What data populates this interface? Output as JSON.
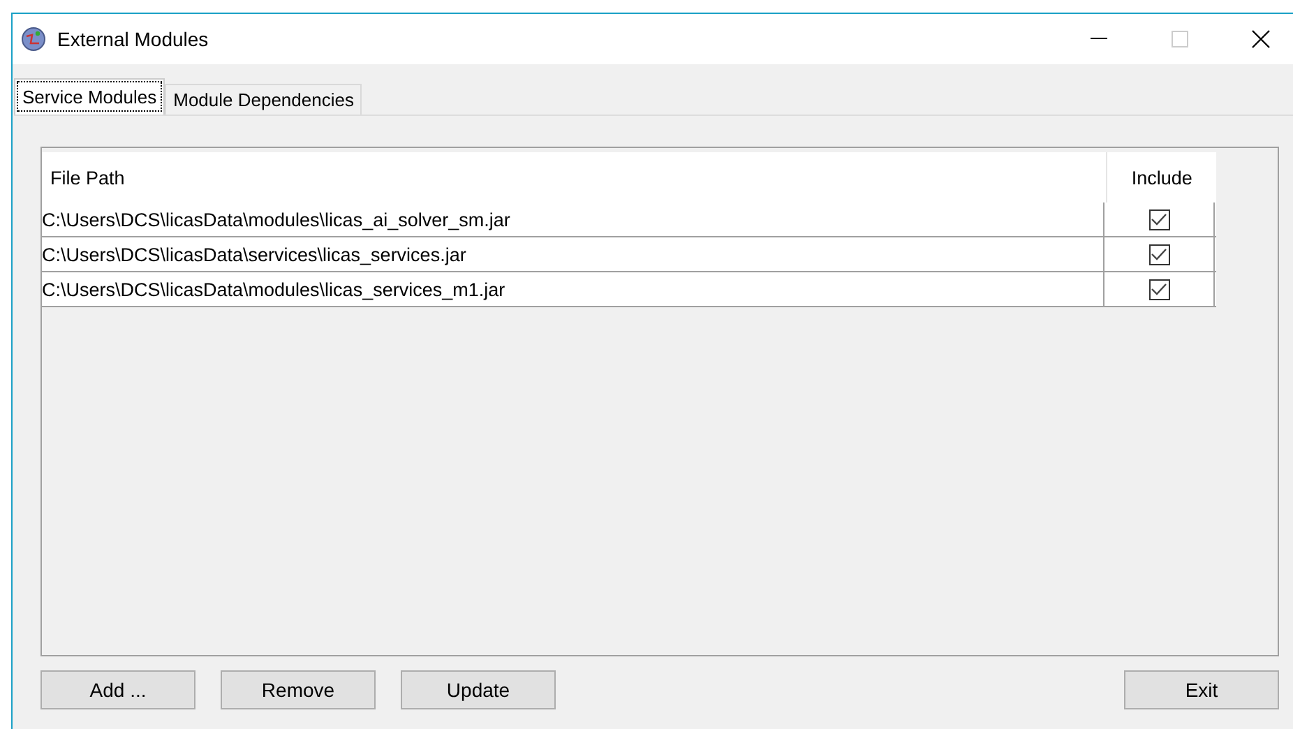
{
  "window": {
    "title": "External Modules",
    "maximize_disabled": true
  },
  "tabs": [
    {
      "label": "Service Modules",
      "selected": true
    },
    {
      "label": "Module Dependencies",
      "selected": false
    }
  ],
  "table": {
    "columns": [
      "File Path",
      "Include"
    ],
    "rows": [
      {
        "path": "C:\\Users\\DCS\\licasData\\modules\\licas_ai_solver_sm.jar",
        "checked": true
      },
      {
        "path": "C:\\Users\\DCS\\licasData\\services\\licas_services.jar",
        "checked": true
      },
      {
        "path": "C:\\Users\\DCS\\licasData\\modules\\licas_services_m1.jar",
        "checked": true
      }
    ]
  },
  "buttons": [
    "Add ...",
    "Remove",
    "Update"
  ],
  "exit_button": "Exit"
}
